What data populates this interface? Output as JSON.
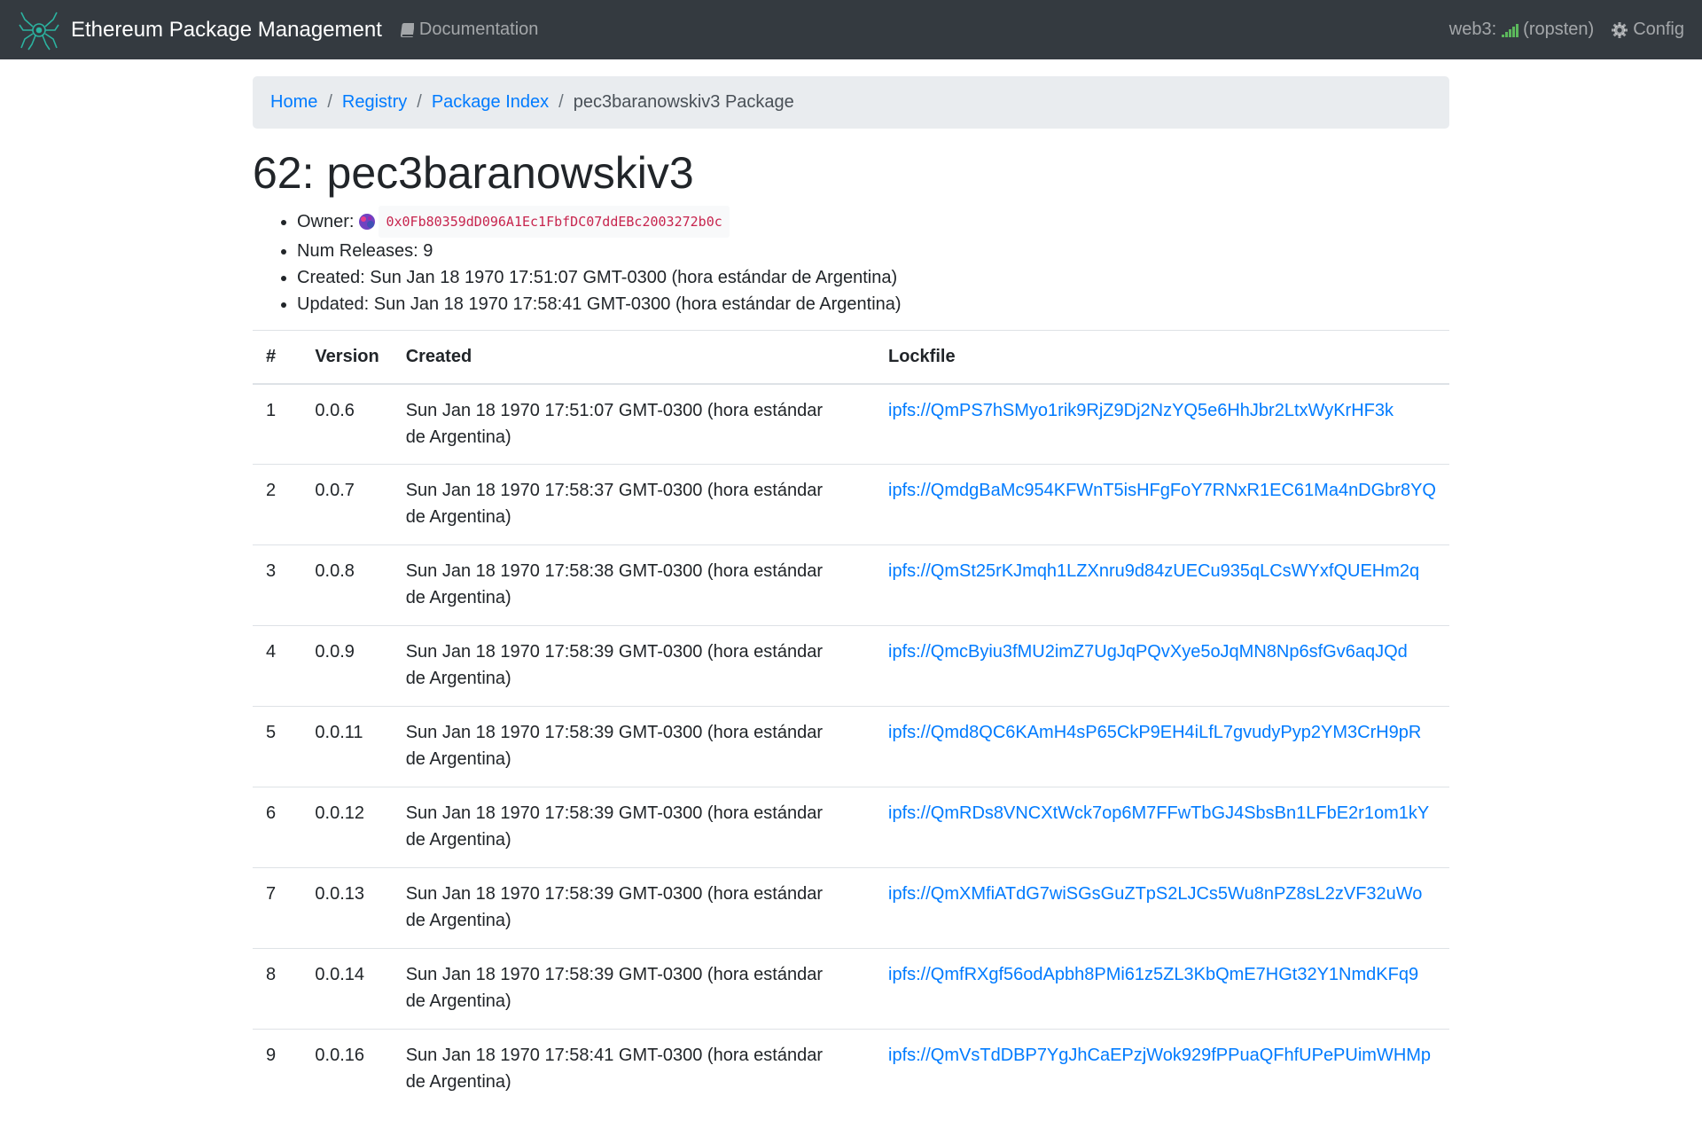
{
  "navbar": {
    "brand": "Ethereum Package Management",
    "docs_label": "Documentation",
    "web3_label": "web3:",
    "network": "(ropsten)",
    "config_label": "Config",
    "icons": [
      "ethpm-logo-icon",
      "book-icon",
      "signal-icon",
      "gear-icon"
    ],
    "signal_color": "#5cb85c"
  },
  "breadcrumb": {
    "items": [
      "Home",
      "Registry",
      "Package Index"
    ],
    "separator": "/",
    "active": "pec3baranowskiv3 Package"
  },
  "package": {
    "id": "62:",
    "name": "pec3baranowskiv3",
    "owner_label": "Owner:",
    "owner_address": "0x0Fb80359dD096A1Ec1FbfDC07ddEBc2003272b0c",
    "num_releases_text": "Num Releases: 9",
    "created_text": "Created: Sun Jan 18 1970 17:51:07 GMT-0300 (hora estándar de Argentina)",
    "updated_text": "Updated: Sun Jan 18 1970 17:58:41 GMT-0300 (hora estándar de Argentina)"
  },
  "table": {
    "headers": [
      "#",
      "Version",
      "Created",
      "Lockfile"
    ],
    "rows": [
      {
        "num": "1",
        "version": "0.0.6",
        "created": "Sun Jan 18 1970 17:51:07 GMT-0300 (hora estándar de Argentina)",
        "lockfile": "ipfs://QmPS7hSMyo1rik9RjZ9Dj2NzYQ5e6HhJbr2LtxWyKrHF3k"
      },
      {
        "num": "2",
        "version": "0.0.7",
        "created": "Sun Jan 18 1970 17:58:37 GMT-0300 (hora estándar de Argentina)",
        "lockfile": "ipfs://QmdgBaMc954KFWnT5isHFgFoY7RNxR1EC61Ma4nDGbr8YQ"
      },
      {
        "num": "3",
        "version": "0.0.8",
        "created": "Sun Jan 18 1970 17:58:38 GMT-0300 (hora estándar de Argentina)",
        "lockfile": "ipfs://QmSt25rKJmqh1LZXnru9d84zUECu935qLCsWYxfQUEHm2q"
      },
      {
        "num": "4",
        "version": "0.0.9",
        "created": "Sun Jan 18 1970 17:58:39 GMT-0300 (hora estándar de Argentina)",
        "lockfile": "ipfs://QmcByiu3fMU2imZ7UgJqPQvXye5oJqMN8Np6sfGv6aqJQd"
      },
      {
        "num": "5",
        "version": "0.0.11",
        "created": "Sun Jan 18 1970 17:58:39 GMT-0300 (hora estándar de Argentina)",
        "lockfile": "ipfs://Qmd8QC6KAmH4sP65CkP9EH4iLfL7gvudyPyp2YM3CrH9pR"
      },
      {
        "num": "6",
        "version": "0.0.12",
        "created": "Sun Jan 18 1970 17:58:39 GMT-0300 (hora estándar de Argentina)",
        "lockfile": "ipfs://QmRDs8VNCXtWck7op6M7FFwTbGJ4SbsBn1LFbE2r1om1kY"
      },
      {
        "num": "7",
        "version": "0.0.13",
        "created": "Sun Jan 18 1970 17:58:39 GMT-0300 (hora estándar de Argentina)",
        "lockfile": "ipfs://QmXMfiATdG7wiSGsGuZTpS2LJCs5Wu8nPZ8sL2zVF32uWo"
      },
      {
        "num": "8",
        "version": "0.0.14",
        "created": "Sun Jan 18 1970 17:58:39 GMT-0300 (hora estándar de Argentina)",
        "lockfile": "ipfs://QmfRXgf56odApbh8PMi61z5ZL3KbQmE7HGt32Y1NmdKFq9"
      },
      {
        "num": "9",
        "version": "0.0.16",
        "created": "Sun Jan 18 1970 17:58:41 GMT-0300 (hora estándar de Argentina)",
        "lockfile": "ipfs://QmVsTdDBP7YgJhCaEPzjWok929fPPuaQFhfUPePUimWHMp"
      }
    ]
  },
  "colors": {
    "navbar_bg": "#343a40",
    "link": "#007bff",
    "address": "#c7254e",
    "breadcrumb_bg": "#e9ecef"
  }
}
